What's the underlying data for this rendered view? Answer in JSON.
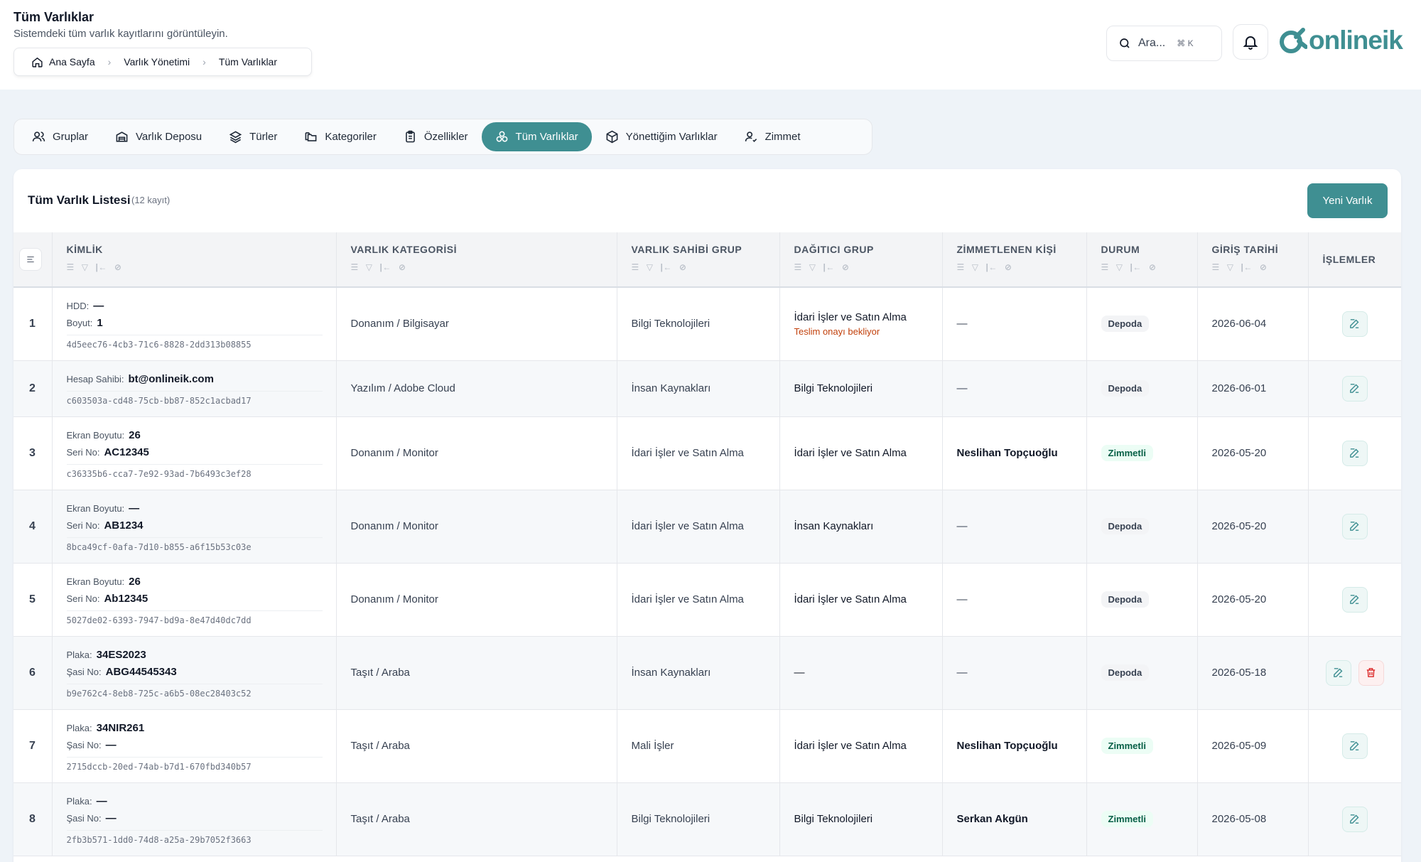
{
  "header": {
    "title": "Tüm Varlıklar",
    "subtitle": "Sistemdeki tüm varlık kayıtlarını görüntüleyin.",
    "breadcrumb": [
      "Ana Sayfa",
      "Varlık Yönetimi",
      "Tüm Varlıklar"
    ],
    "search_placeholder": "Ara...",
    "search_shortcut": "⌘ K",
    "logo_text": "onlineik"
  },
  "tabs": [
    {
      "label": "Gruplar",
      "icon": "users-icon"
    },
    {
      "label": "Varlık Deposu",
      "icon": "warehouse-icon"
    },
    {
      "label": "Türler",
      "icon": "layers-icon"
    },
    {
      "label": "Kategoriler",
      "icon": "folders-icon"
    },
    {
      "label": "Özellikler",
      "icon": "clipboard-icon"
    },
    {
      "label": "Tüm Varlıklar",
      "icon": "assets-icon",
      "active": true
    },
    {
      "label": "Yönettiğim Varlıklar",
      "icon": "box-icon"
    },
    {
      "label": "Zimmet",
      "icon": "user-check-icon"
    }
  ],
  "list": {
    "title": "Tüm Varlık Listesi",
    "count": "(12 kayıt)",
    "new_button": "Yeni Varlık"
  },
  "columns": [
    "KİMLİK",
    "VARLIK KATEGORİSİ",
    "VARLIK SAHİBİ GRUP",
    "DAĞITICI GRUP",
    "ZİMMETLENEN KİŞİ",
    "DURUM",
    "GİRİŞ TARİHİ",
    "İŞLEMLER"
  ],
  "rows": [
    {
      "no": "1",
      "f1_label": "HDD:",
      "f1_value": "—",
      "f2_label": "Boyut:",
      "f2_value": "1",
      "uuid": "4d5eec76-4cb3-71c6-8828-2dd313b08855",
      "category": "Donanım / Bilgisayar",
      "owner": "Bilgi Teknolojileri",
      "distributor": "İdari İşler ve Satın Alma",
      "distributor_note": "Teslim onayı bekliyor",
      "person": "—",
      "status": "Depoda",
      "date": "2026-06-04"
    },
    {
      "no": "2",
      "f1_label": "Hesap Sahibi:",
      "f1_value": "bt@onlineik.com",
      "f2_label": "",
      "f2_value": "",
      "uuid": "c603503a-cd48-75cb-bb87-852c1acbad17",
      "category": "Yazılım / Adobe Cloud",
      "owner": "İnsan Kaynakları",
      "distributor": "Bilgi Teknolojileri",
      "distributor_note": "",
      "person": "—",
      "status": "Depoda",
      "date": "2026-06-01"
    },
    {
      "no": "3",
      "f1_label": "Ekran Boyutu:",
      "f1_value": "26",
      "f2_label": "Seri No:",
      "f2_value": "AC12345",
      "uuid": "c36335b6-cca7-7e92-93ad-7b6493c3ef28",
      "category": "Donanım / Monitor",
      "owner": "İdari İşler ve Satın Alma",
      "distributor": "İdari İşler ve Satın Alma",
      "distributor_note": "",
      "person": "Neslihan Topçuoğlu",
      "status": "Zimmetli",
      "date": "2026-05-20"
    },
    {
      "no": "4",
      "f1_label": "Ekran Boyutu:",
      "f1_value": "—",
      "f2_label": "Seri No:",
      "f2_value": "AB1234",
      "uuid": "8bca49cf-0afa-7d10-b855-a6f15b53c03e",
      "category": "Donanım / Monitor",
      "owner": "İdari İşler ve Satın Alma",
      "distributor": "İnsan Kaynakları",
      "distributor_note": "",
      "person": "—",
      "status": "Depoda",
      "date": "2026-05-20"
    },
    {
      "no": "5",
      "f1_label": "Ekran Boyutu:",
      "f1_value": "26",
      "f2_label": "Seri No:",
      "f2_value": "Ab12345",
      "uuid": "5027de02-6393-7947-bd9a-8e47d40dc7dd",
      "category": "Donanım / Monitor",
      "owner": "İdari İşler ve Satın Alma",
      "distributor": "İdari İşler ve Satın Alma",
      "distributor_note": "",
      "person": "—",
      "status": "Depoda",
      "date": "2026-05-20"
    },
    {
      "no": "6",
      "f1_label": "Plaka:",
      "f1_value": "34ES2023",
      "f2_label": "Şasi No:",
      "f2_value": "ABG44545343",
      "uuid": "b9e762c4-8eb8-725c-a6b5-08ec28403c52",
      "category": "Taşıt / Araba",
      "owner": "İnsan Kaynakları",
      "distributor": "—",
      "distributor_note": "",
      "person": "—",
      "status": "Depoda",
      "date": "2026-05-18",
      "deletable": true
    },
    {
      "no": "7",
      "f1_label": "Plaka:",
      "f1_value": "34NIR261",
      "f2_label": "Şasi No:",
      "f2_value": "—",
      "uuid": "2715dccb-20ed-74ab-b7d1-670fbd340b57",
      "category": "Taşıt / Araba",
      "owner": "Mali İşler",
      "distributor": "İdari İşler ve Satın Alma",
      "distributor_note": "",
      "person": "Neslihan Topçuoğlu",
      "status": "Zimmetli",
      "date": "2026-05-09"
    },
    {
      "no": "8",
      "f1_label": "Plaka:",
      "f1_value": "—",
      "f2_label": "Şasi No:",
      "f2_value": "—",
      "uuid": "2fb3b571-1dd0-74d8-a25a-29b7052f3663",
      "category": "Taşıt / Araba",
      "owner": "Bilgi Teknolojileri",
      "distributor": "Bilgi Teknolojileri",
      "distributor_note": "",
      "person": "Serkan Akgün",
      "status": "Zimmetli",
      "date": "2026-05-08"
    }
  ],
  "colors": {
    "accent": "#3f8f92",
    "pending": "#c2410c",
    "delete": "#dc2626"
  }
}
